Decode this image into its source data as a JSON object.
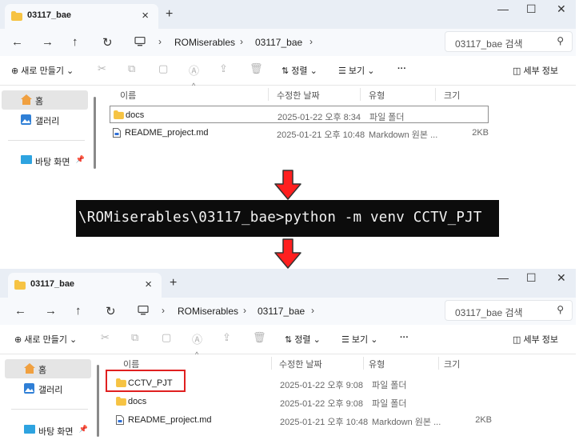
{
  "window_before": {
    "tab_title": "03117_bae",
    "new_tab": "+",
    "window_controls": {
      "minimize": "—",
      "maximize": "☐",
      "close": "✕"
    },
    "nav": {
      "back": "←",
      "forward": "→",
      "up": "↑",
      "refresh": "↻"
    },
    "breadcrumb": [
      "ROMiserables",
      "03117_bae"
    ],
    "search_placeholder": "03117_bae 검색",
    "toolbar": {
      "new": "새로 만들기",
      "sort": "정렬",
      "view": "보기",
      "more": "···",
      "details": "세부 정보"
    },
    "sidebar": {
      "home": "홈",
      "gallery": "갤러리",
      "desktop": "바탕 화면"
    },
    "columns": {
      "name": "이름",
      "date": "수정한 날짜",
      "type": "유형",
      "size": "크기"
    },
    "files": [
      {
        "name": "docs",
        "date": "2025-01-22 오후 8:34",
        "type": "파일 폴더",
        "size": "",
        "icon": "folder-icon"
      },
      {
        "name": "README_project.md",
        "date": "2025-01-21 오후 10:48",
        "type": "Markdown 원본 ...",
        "size": "2KB",
        "icon": "file-icon"
      }
    ]
  },
  "command": "\\ROMiserables\\03117_bae>python -m venv CCTV_PJT",
  "window_after": {
    "tab_title": "03117_bae",
    "new_tab": "+",
    "window_controls": {
      "minimize": "—",
      "maximize": "☐",
      "close": "✕"
    },
    "nav": {
      "back": "←",
      "forward": "→",
      "up": "↑",
      "refresh": "↻"
    },
    "breadcrumb": [
      "ROMiserables",
      "03117_bae"
    ],
    "search_placeholder": "03117_bae 검색",
    "toolbar": {
      "new": "새로 만들기",
      "sort": "정렬",
      "view": "보기",
      "more": "···",
      "details": "세부 정보"
    },
    "sidebar": {
      "home": "홈",
      "gallery": "갤러리",
      "desktop": "바탕 화면"
    },
    "columns": {
      "name": "이름",
      "date": "수정한 날짜",
      "type": "유형",
      "size": "크기"
    },
    "files": [
      {
        "name": "CCTV_PJT",
        "date": "2025-01-22 오후 9:08",
        "type": "파일 폴더",
        "size": "",
        "icon": "folder-icon"
      },
      {
        "name": "docs",
        "date": "2025-01-22 오후 9:08",
        "type": "파일 폴더",
        "size": "",
        "icon": "folder-icon"
      },
      {
        "name": "README_project.md",
        "date": "2025-01-21 오후 10:48",
        "type": "Markdown 원본 ...",
        "size": "2KB",
        "icon": "file-icon"
      }
    ]
  },
  "colors": {
    "highlight_red": "#e02020",
    "titlebar": "#e9eef5",
    "folder_yellow": "#f6c343",
    "terminal_bg": "#0c0c0c"
  }
}
